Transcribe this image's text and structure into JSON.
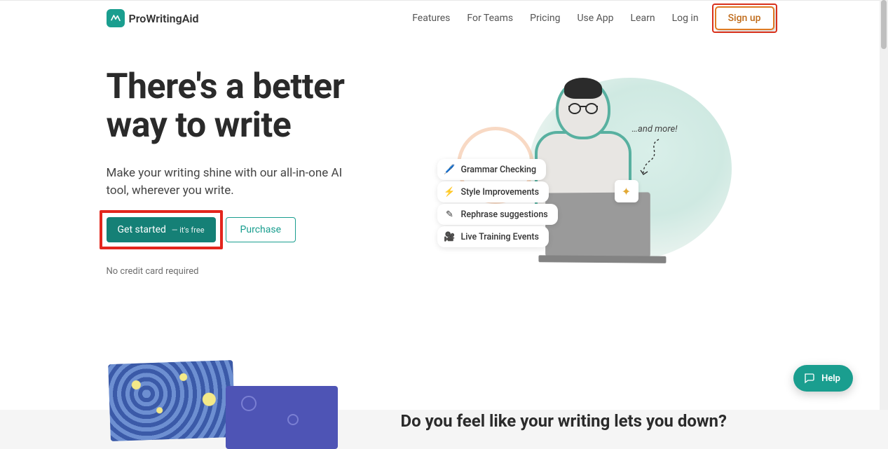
{
  "brand": {
    "name": "ProWritingAid"
  },
  "nav": {
    "features": "Features",
    "teams": "For Teams",
    "pricing": "Pricing",
    "useapp": "Use App",
    "learn": "Learn",
    "login": "Log in",
    "signup": "Sign up"
  },
  "hero": {
    "title": "There's a better way to write",
    "subtitle": "Make your writing shine with our all-in-one AI tool, wherever you write.",
    "cta_primary": "Get started",
    "cta_primary_sub": "— it's free",
    "cta_secondary": "Purchase",
    "note": "No credit card required",
    "more_label": "…and more!",
    "pills": {
      "grammar": "Grammar Checking",
      "style": "Style Improvements",
      "rephrase": "Rephrase suggestions",
      "training": "Live Training Events"
    }
  },
  "section2": {
    "heading": "Do you feel like your writing lets you down?"
  },
  "help": {
    "label": "Help"
  },
  "colors": {
    "accent": "#1a9e8f",
    "highlight_red": "#e3261d",
    "highlight_orange": "#df7b23"
  }
}
